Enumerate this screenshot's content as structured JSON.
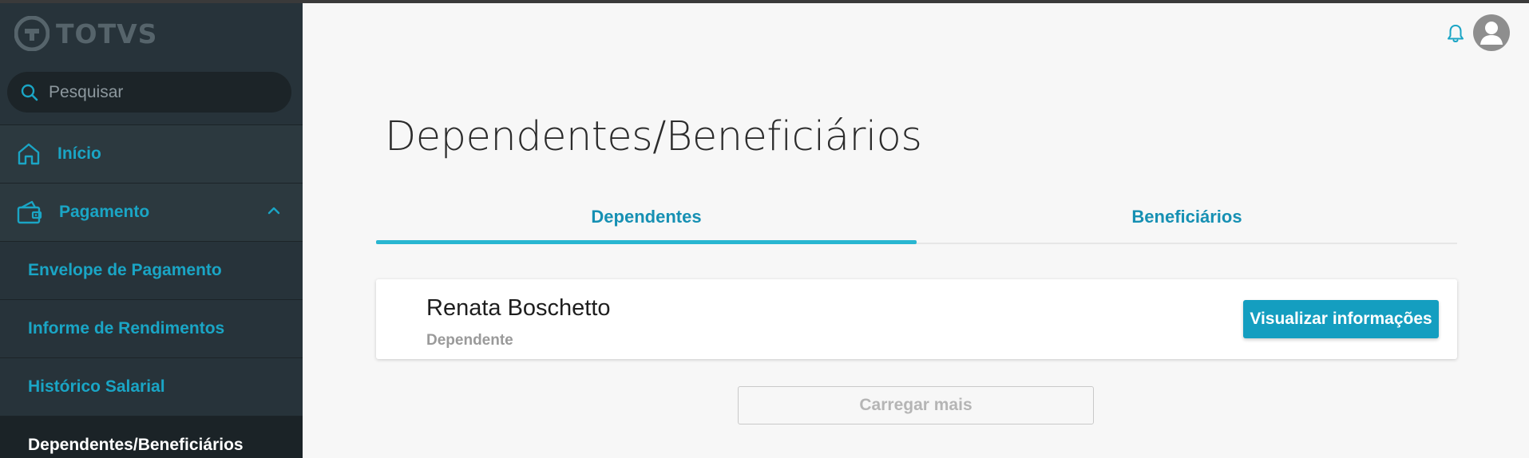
{
  "brand": {
    "name": "TOTVS"
  },
  "search": {
    "placeholder": "Pesquisar",
    "value": ""
  },
  "sidebar": {
    "items": [
      {
        "label": "Início",
        "icon": "home-icon"
      },
      {
        "label": "Pagamento",
        "icon": "wallet-icon",
        "expanded": true
      },
      {
        "label": "Envelope de Pagamento"
      },
      {
        "label": "Informe de Rendimentos"
      },
      {
        "label": "Histórico Salarial"
      },
      {
        "label": "Dependentes/Beneficiários",
        "active": true
      }
    ]
  },
  "header": {
    "notification_icon": "bell-icon",
    "avatar_icon": "user-icon"
  },
  "main": {
    "title": "Dependentes/Beneficiários",
    "tabs": [
      {
        "label": "Dependentes",
        "active": true
      },
      {
        "label": "Beneficiários",
        "active": false
      }
    ],
    "cards": [
      {
        "name": "Renata Boschetto",
        "role": "Dependente",
        "button_label": "Visualizar informações"
      }
    ],
    "load_more_label": "Carregar mais"
  },
  "colors": {
    "sidebar_bg": "#27333a",
    "accent": "#1aa5c5",
    "button": "#149ec0",
    "tab_indicator": "#29b6d1"
  }
}
